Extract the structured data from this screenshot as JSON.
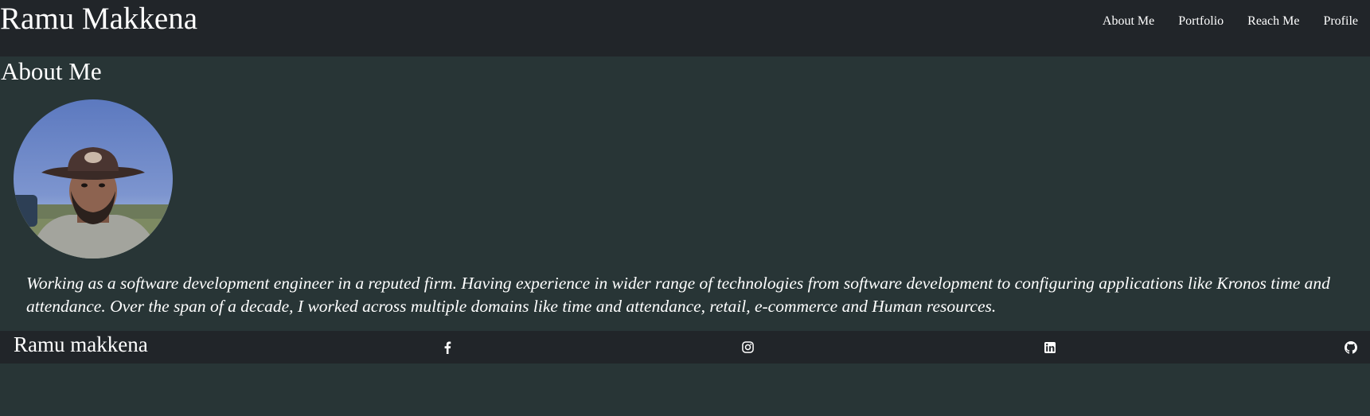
{
  "header": {
    "brand": "Ramu Makkena",
    "nav": [
      {
        "label": "About Me"
      },
      {
        "label": "Portfolio"
      },
      {
        "label": "Reach Me"
      },
      {
        "label": "Profile"
      }
    ]
  },
  "main": {
    "title": "About Me",
    "avatar_alt": "profile-photo",
    "paragraph": "Working as a software development engineer in a reputed firm. Having experience in wider range of technologies from software development to configuring applications like Kronos time and attendance. Over the span of a decade, I worked across multiple domains like time and attendance, retail, e-commerce and Human resources."
  },
  "footer": {
    "name": "Ramu makkena",
    "social_icons": [
      "facebook-icon",
      "instagram-icon",
      "linkedin-icon",
      "github-icon"
    ]
  },
  "colors": {
    "navbar_bg": "#212529",
    "page_bg": "#283536",
    "text": "#ffffff"
  }
}
